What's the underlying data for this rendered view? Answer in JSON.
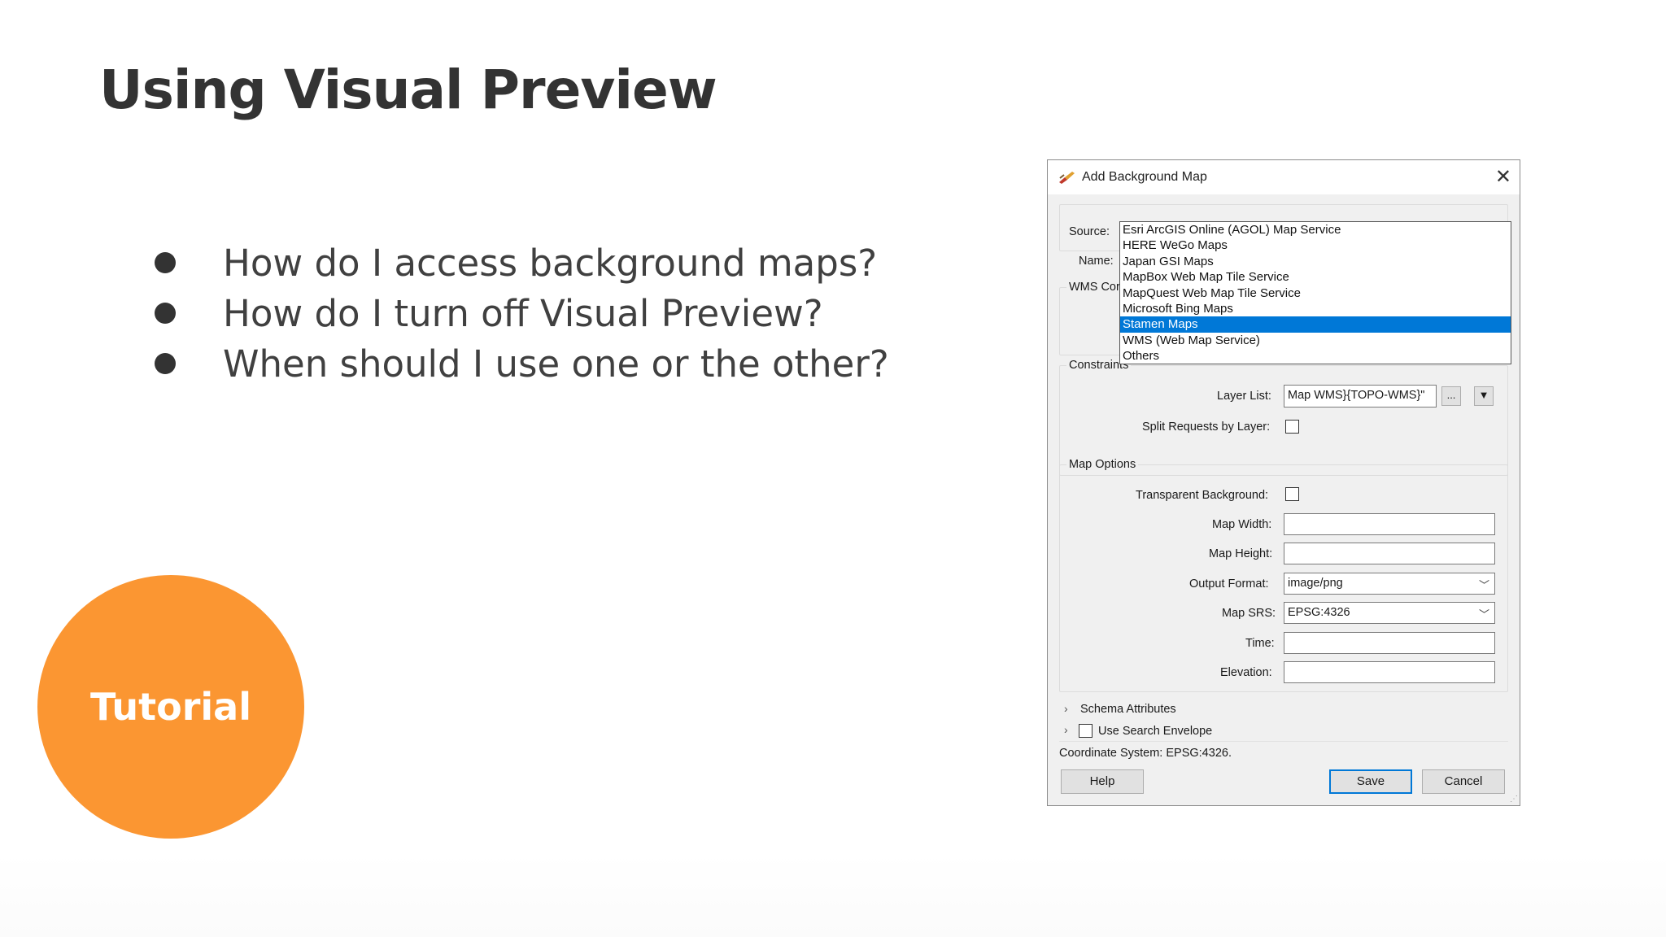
{
  "slide": {
    "title": "Using Visual Preview",
    "bullets": [
      "How do I access background maps?",
      "How do I turn off Visual Preview?",
      "When should I use one or the other?"
    ],
    "badge": "Tutorial",
    "badge_color": "#fb9632"
  },
  "dialog": {
    "title": "Add Background Map",
    "icon": "brush-icon",
    "source_label": "Source:",
    "name_label": "Name:",
    "wms_label": "WMS Cor",
    "constraints_label": "Constraints",
    "source_options": [
      "Esri ArcGIS Online (AGOL) Map Service",
      "HERE WeGo Maps",
      "Japan GSI Maps",
      "MapBox Web Map Tile Service",
      "MapQuest Web Map Tile Service",
      "Microsoft Bing Maps",
      "Stamen Maps",
      "WMS (Web Map Service)",
      "Others"
    ],
    "selected_option": "Stamen Maps",
    "layer_list_label": "Layer List:",
    "layer_list_value": "Map WMS}{TOPO-WMS}\"",
    "ellipsis_button": "...",
    "split_requests_label": "Split Requests by Layer:",
    "map_options_label": "Map Options",
    "transparent_bg_label": "Transparent Background:",
    "map_width_label": "Map Width:",
    "map_height_label": "Map Height:",
    "output_format_label": "Output Format:",
    "output_format_value": "image/png",
    "map_srs_label": "Map SRS:",
    "map_srs_value": "EPSG:4326",
    "time_label": "Time:",
    "elevation_label": "Elevation:",
    "schema_attributes_label": "Schema Attributes",
    "use_search_envelope_label": "Use Search Envelope",
    "coordinate_system_text": "Coordinate System: EPSG:4326.",
    "help_button": "Help",
    "save_button": "Save",
    "cancel_button": "Cancel",
    "accent_color": "#0078d7"
  }
}
